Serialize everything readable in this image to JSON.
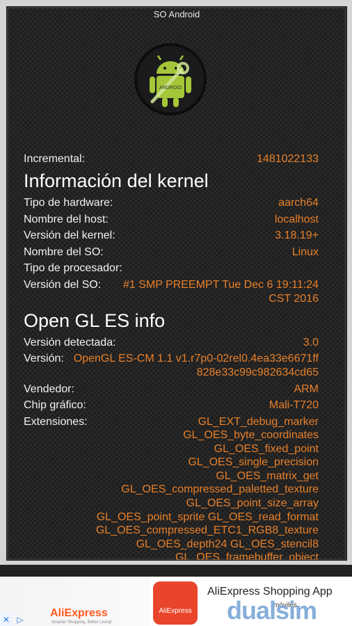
{
  "app": {
    "title": "SO Android"
  },
  "rows_top": [
    {
      "label": "Incremental:",
      "value": "1481022133"
    }
  ],
  "kernel": {
    "heading": "Información del kernel",
    "rows": [
      {
        "label": "Tipo de hardware:",
        "value": "aarch64"
      },
      {
        "label": "Nombre del host:",
        "value": "localhost"
      },
      {
        "label": "Versión del kernel:",
        "value": "3.18.19+"
      },
      {
        "label": "Nombre del SO:",
        "value": "Linux"
      },
      {
        "label": "Tipo de procesador:",
        "value": ""
      },
      {
        "label": "Versión del SO:",
        "value": "#1 SMP PREEMPT Tue Dec 6 19:11:24 CST 2016"
      }
    ]
  },
  "opengl": {
    "heading": "Open GL ES info",
    "rows": [
      {
        "label": "Versión detectada:",
        "value": "3.0"
      },
      {
        "label": "Versión:",
        "value": "OpenGL ES-CM 1.1 v1.r7p0-02rel0.4ea33e6671ff 828e33c99c982634cd65"
      },
      {
        "label": "Vendedor:",
        "value": "ARM"
      },
      {
        "label": "Chip gráfico:",
        "value": "Mali-T720"
      }
    ],
    "extensions_label": "Extensiones:",
    "extensions": [
      "GL_EXT_debug_marker",
      "GL_OES_byte_coordinates",
      "GL_OES_fixed_point",
      "GL_OES_single_precision",
      "GL_OES_matrix_get",
      "GL_OES_compressed_paletted_texture",
      "GL_OES_point_size_array",
      "GL_OES_point_sprite GL_OES_read_format",
      "GL_OES_compressed_ETC1_RGB8_texture",
      "GL_OES_depth24 GL_OES_stencil8",
      "GL_OES_framebuffer_object"
    ]
  },
  "ad": {
    "brand": "AliExpress",
    "tagline": "Smarter Shopping, Better Living!",
    "icon_label": "AliExpress",
    "app_name": "AliExpress Shopping App",
    "sub": "móviles",
    "watermark": "dualsim"
  },
  "colors": {
    "accent": "#e8802a",
    "label": "#f2f2f2",
    "background": "#242424"
  }
}
